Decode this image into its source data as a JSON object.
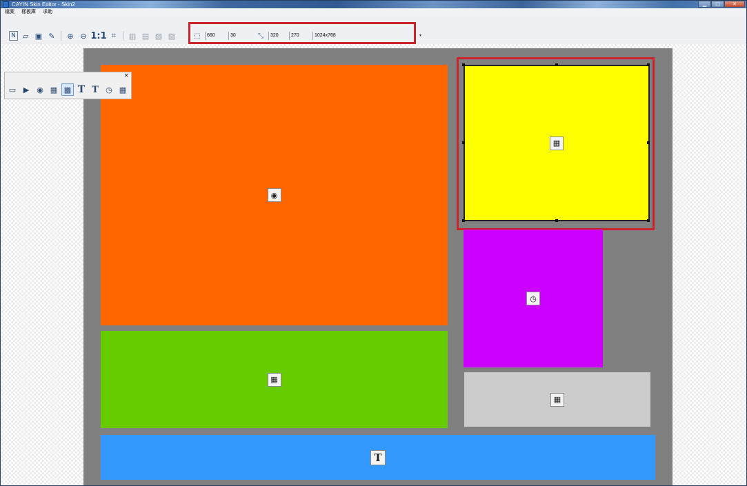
{
  "window": {
    "title": "CAYIN Skin Editor - Skin2",
    "minimize": "▁",
    "maximize": "□",
    "close": "✕"
  },
  "menu": [
    {
      "label": "檔案"
    },
    {
      "label": "樣板庫"
    },
    {
      "label": "求助"
    }
  ],
  "toolbar": {
    "tools": [
      {
        "name": "new-icon",
        "glyph": "N"
      },
      {
        "name": "open-icon",
        "glyph": "▱"
      },
      {
        "name": "save-icon",
        "glyph": "▣"
      },
      {
        "name": "edit-icon",
        "glyph": "✎"
      },
      {
        "name": "zoom-in-icon",
        "glyph": "⊕"
      },
      {
        "name": "zoom-out-icon",
        "glyph": "⊖"
      },
      {
        "name": "actual-size-label",
        "glyph": "1:1"
      },
      {
        "name": "fit-icon",
        "glyph": "⌗"
      },
      {
        "name": "align-top-icon",
        "glyph": "▥"
      },
      {
        "name": "align-bottom-icon",
        "glyph": "▤"
      },
      {
        "name": "align-left-icon",
        "glyph": "▧"
      },
      {
        "name": "align-right-icon",
        "glyph": "▨"
      }
    ],
    "props": {
      "position_x": "660",
      "position_y": "30",
      "size_w": "320",
      "size_h": "270",
      "resolution": "1024x768"
    }
  },
  "palette": {
    "close": "×",
    "items": [
      {
        "name": "background-icon",
        "glyph": "▭"
      },
      {
        "name": "video-zone-icon",
        "glyph": "▶"
      },
      {
        "name": "media-zone-icon",
        "glyph": "◉"
      },
      {
        "name": "image-zone-icon",
        "glyph": "▦"
      },
      {
        "name": "flash-zone-icon",
        "glyph": "▩"
      },
      {
        "name": "text-zone-icon",
        "glyph": "T"
      },
      {
        "name": "ticker-text-icon",
        "glyph": "T"
      },
      {
        "name": "clock-zone-icon",
        "glyph": "◷"
      },
      {
        "name": "calendar-zone-icon",
        "glyph": "▦"
      }
    ]
  },
  "regions": [
    {
      "name": "video-zone",
      "color": "#ff6600",
      "icon_glyph": "◉"
    },
    {
      "name": "flash-zone",
      "color": "#ffff00",
      "icon_glyph": "▦"
    },
    {
      "name": "clock-zone",
      "color": "#cc00ff",
      "icon_glyph": "◷"
    },
    {
      "name": "image-zone",
      "color": "#66cc00",
      "icon_glyph": "▦"
    },
    {
      "name": "date-zone",
      "color": "#cccccc",
      "icon_glyph": "▦"
    },
    {
      "name": "ticker-zone",
      "color": "#3399ff",
      "icon_glyph": "T"
    }
  ]
}
